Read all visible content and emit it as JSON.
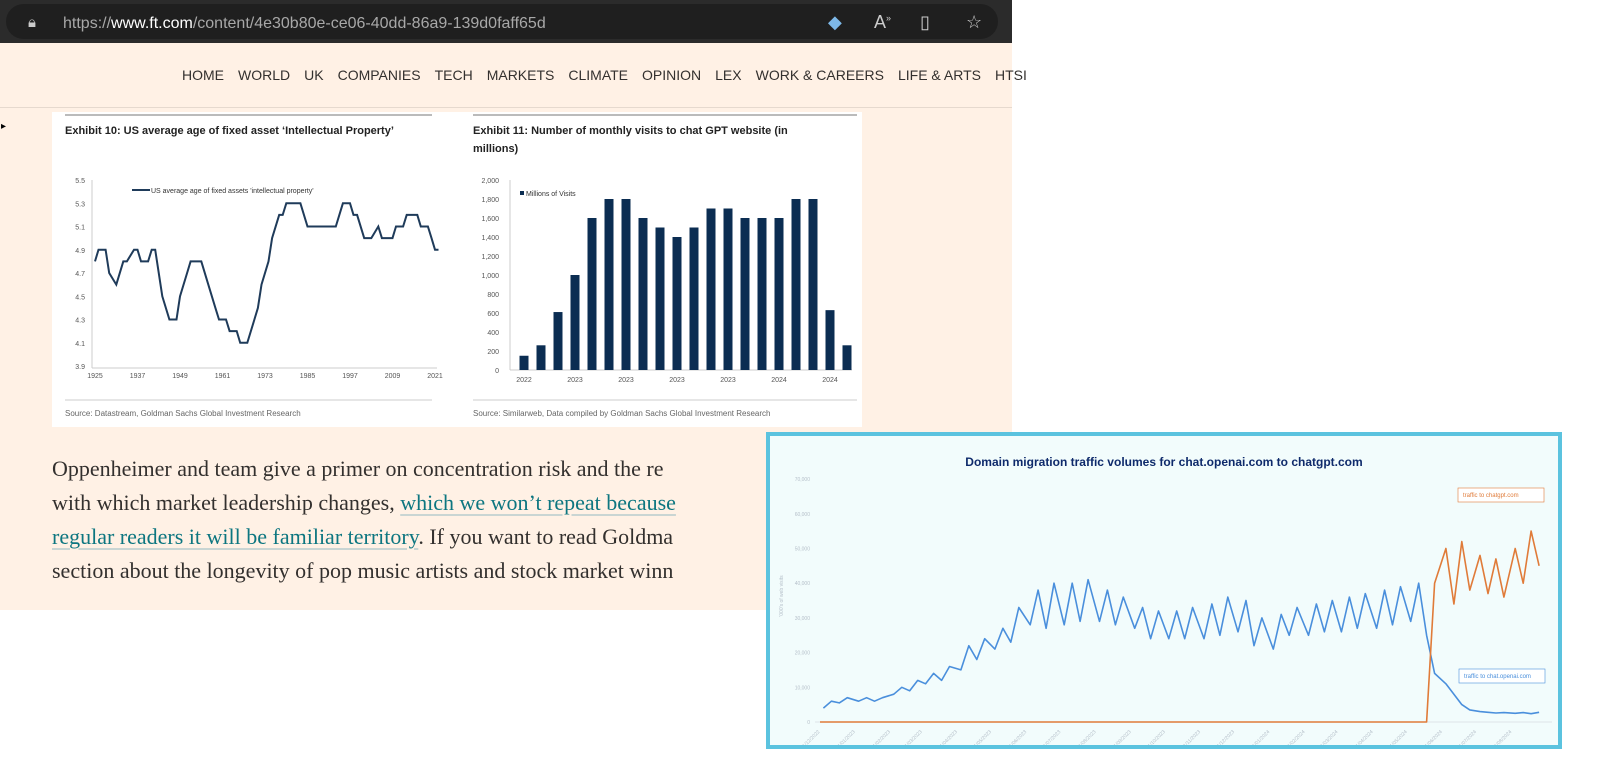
{
  "browser": {
    "url_prefix": "https://",
    "url_domain": "www.ft.com",
    "url_path": "/content/4e30b80e-ce06-40dd-86a9-139d0faff65d",
    "icons": [
      "lock-icon",
      "tag-icon",
      "read-aloud-icon",
      "immersive-reader-icon",
      "favorite-star-icon"
    ]
  },
  "nav": {
    "items": [
      "HOME",
      "WORLD",
      "UK",
      "COMPANIES",
      "TECH",
      "MARKETS",
      "CLIMATE",
      "OPINION",
      "LEX",
      "WORK & CAREERS",
      "LIFE & ARTS",
      "HTSI"
    ]
  },
  "article": {
    "line1": "Oppenheimer and team give a primer on concentration risk and the re",
    "line2_text": "with which market leadership changes, ",
    "line2_link": "which we won’t repeat because",
    "line3_link": "regular readers it will be familiar territory",
    "line3_text": ". If you want to read Goldma",
    "line4": "section about the longevity of pop music artists and stock market winn"
  },
  "chart_data": [
    {
      "type": "line",
      "title": "Exhibit 10: US average age of fixed asset ‘Intellectual Property’",
      "legend": "US average age of fixed assets 'intellectual property'",
      "legend_position": "top-left",
      "source": "Source: Datastream, Goldman Sachs Global Investment Research",
      "xlim": [
        1925,
        2022
      ],
      "ylim": [
        3.9,
        5.5
      ],
      "xticks": [
        "1925",
        "1937",
        "1949",
        "1961",
        "1973",
        "1985",
        "1997",
        "2009",
        "2021"
      ],
      "yticks": [
        "3.9",
        "4.1",
        "4.3",
        "4.5",
        "4.7",
        "4.9",
        "5.1",
        "5.3",
        "5.5"
      ],
      "color": "#1f3b5a",
      "points": [
        [
          1925,
          4.8
        ],
        [
          1926,
          4.9
        ],
        [
          1928,
          4.9
        ],
        [
          1929,
          4.7
        ],
        [
          1931,
          4.6
        ],
        [
          1933,
          4.8
        ],
        [
          1934,
          4.8
        ],
        [
          1936,
          4.9
        ],
        [
          1937,
          4.9
        ],
        [
          1938,
          4.8
        ],
        [
          1940,
          4.8
        ],
        [
          1941,
          4.9
        ],
        [
          1942,
          4.9
        ],
        [
          1944,
          4.5
        ],
        [
          1946,
          4.3
        ],
        [
          1948,
          4.3
        ],
        [
          1949,
          4.5
        ],
        [
          1951,
          4.7
        ],
        [
          1952,
          4.8
        ],
        [
          1955,
          4.8
        ],
        [
          1957,
          4.6
        ],
        [
          1959,
          4.4
        ],
        [
          1960,
          4.3
        ],
        [
          1962,
          4.3
        ],
        [
          1963,
          4.2
        ],
        [
          1965,
          4.2
        ],
        [
          1966,
          4.1
        ],
        [
          1968,
          4.1
        ],
        [
          1970,
          4.3
        ],
        [
          1971,
          4.4
        ],
        [
          1972,
          4.6
        ],
        [
          1974,
          4.8
        ],
        [
          1975,
          5.0
        ],
        [
          1977,
          5.2
        ],
        [
          1978,
          5.2
        ],
        [
          1979,
          5.3
        ],
        [
          1983,
          5.3
        ],
        [
          1985,
          5.1
        ],
        [
          1993,
          5.1
        ],
        [
          1995,
          5.3
        ],
        [
          1997,
          5.3
        ],
        [
          1998,
          5.2
        ],
        [
          1999,
          5.2
        ],
        [
          2001,
          5.0
        ],
        [
          2003,
          5.0
        ],
        [
          2005,
          5.1
        ],
        [
          2006,
          5.0
        ],
        [
          2009,
          5.0
        ],
        [
          2010,
          5.1
        ],
        [
          2012,
          5.1
        ],
        [
          2013,
          5.2
        ],
        [
          2016,
          5.2
        ],
        [
          2017,
          5.1
        ],
        [
          2019,
          5.1
        ],
        [
          2020,
          5.0
        ],
        [
          2021,
          4.9
        ],
        [
          2022,
          4.9
        ]
      ]
    },
    {
      "type": "bar",
      "title": "Exhibit 11: Number of monthly visits to chat GPT website (in millions)",
      "legend": "Millions of Visits",
      "legend_position": "top-left",
      "source": "Source: Similarweb, Data compiled by Goldman Sachs Global Investment Research",
      "ylim": [
        0,
        2000
      ],
      "yticks": [
        "0",
        "200",
        "400",
        "600",
        "800",
        "1,000",
        "1,200",
        "1,400",
        "1,600",
        "1,800",
        "2,000"
      ],
      "xtick_labels": [
        "2022",
        "",
        "",
        "2023",
        "",
        "",
        "2023",
        "",
        "",
        "2023",
        "",
        "",
        "2023",
        "",
        "",
        "2024",
        "",
        "",
        "2024",
        ""
      ],
      "values": [
        150,
        260,
        610,
        1000,
        1600,
        1800,
        1800,
        1600,
        1500,
        1400,
        1500,
        1700,
        1700,
        1600,
        1600,
        1600,
        1800,
        1800,
        630,
        260
      ],
      "color": "#0b2d52"
    },
    {
      "type": "line",
      "title": "Domain migration traffic volumes for chat.openai.com to chatgpt.com",
      "ylabel": "'000's of web visits",
      "ylim": [
        0,
        70000
      ],
      "yticks": [
        "0",
        "10,000",
        "20,000",
        "30,000",
        "40,000",
        "50,000",
        "60,000",
        "70,000"
      ],
      "xticks": [
        "01/12/2022",
        "01/01/2023",
        "01/02/2023",
        "01/03/2023",
        "01/04/2023",
        "01/05/2023",
        "01/06/2023",
        "01/07/2023",
        "01/08/2023",
        "01/09/2023",
        "01/10/2023",
        "01/11/2023",
        "01/12/2023",
        "01/01/2024",
        "01/02/2024",
        "01/03/2024",
        "01/04/2024",
        "01/05/2024",
        "01/06/2024",
        "01/07/2024",
        "01/08/2024"
      ],
      "series": [
        {
          "name": "traffic to chat.openai.com",
          "color": "#4a8fdc",
          "weekly_by_month": [
            [
              "2022-12",
              [
                4000,
                6000,
                5500,
                7000
              ]
            ],
            [
              "2023-01",
              [
                6000,
                7000,
                6000,
                7000
              ]
            ],
            [
              "2023-02",
              [
                8000,
                10000,
                9000,
                12000
              ]
            ],
            [
              "2023-03",
              [
                11000,
                14000,
                12000,
                16000
              ]
            ],
            [
              "2023-04",
              [
                15000,
                22000,
                18000,
                24000
              ]
            ],
            [
              "2023-05",
              [
                21000,
                27000,
                23000,
                33000
              ]
            ],
            [
              "2023-06",
              [
                28000,
                38000,
                27000,
                40000
              ]
            ],
            [
              "2023-07",
              [
                28000,
                40000,
                29000,
                41000
              ]
            ],
            [
              "2023-08",
              [
                29000,
                38000,
                28000,
                36000
              ]
            ],
            [
              "2023-09",
              [
                27000,
                33000,
                24000,
                32000
              ]
            ],
            [
              "2023-10",
              [
                24000,
                32000,
                24000,
                33000
              ]
            ],
            [
              "2023-11",
              [
                24000,
                34000,
                25000,
                36000
              ]
            ],
            [
              "2023-12",
              [
                26000,
                35000,
                22000,
                30000
              ]
            ],
            [
              "2024-01",
              [
                21000,
                31000,
                25000,
                33000
              ]
            ],
            [
              "2024-02",
              [
                25000,
                34000,
                26000,
                35000
              ]
            ],
            [
              "2024-03",
              [
                26000,
                36000,
                27000,
                37000
              ]
            ],
            [
              "2024-04",
              [
                27000,
                38000,
                28000,
                39000
              ]
            ],
            [
              "2024-05",
              [
                29000,
                40000,
                25000,
                14000
              ]
            ],
            [
              "2024-06",
              [
                11000,
                8000,
                5000,
                3500
              ]
            ],
            [
              "2024-07",
              [
                3000,
                2800,
                2600,
                2700
              ]
            ],
            [
              "2024-08",
              [
                2500,
                2700,
                2400,
                2800
              ]
            ]
          ]
        },
        {
          "name": "traffic to chatgpt.com",
          "color": "#e07b39",
          "weekly_by_month": [
            [
              "2022-12",
              [
                0,
                0,
                0,
                0
              ]
            ],
            [
              "2024-05",
              [
                0,
                0,
                0,
                40000
              ]
            ],
            [
              "2024-06",
              [
                50000,
                34000,
                52000,
                38000
              ]
            ],
            [
              "2024-07",
              [
                48000,
                37000,
                47000,
                36000
              ]
            ],
            [
              "2024-08",
              [
                50000,
                40000,
                55000,
                45000
              ]
            ]
          ]
        }
      ]
    }
  ]
}
